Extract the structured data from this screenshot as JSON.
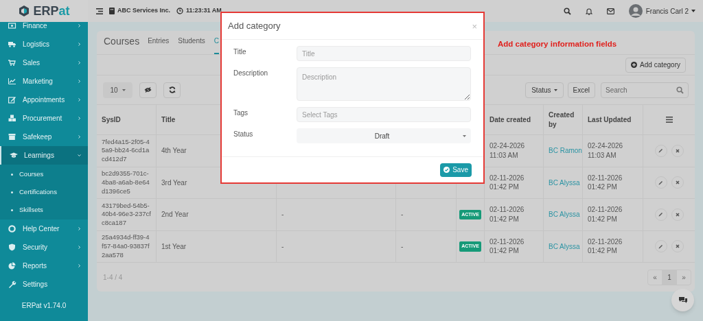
{
  "app": {
    "logo_dark": "ERP",
    "logo_accent": "at",
    "version": "ERPat v1.74.0"
  },
  "header": {
    "company": "ABC Services Inc.",
    "time": "11:23:31 AM",
    "user": "Francis Carl 2"
  },
  "sidebar": {
    "items": [
      {
        "label": "Finance",
        "kind": "menu",
        "expanded": false,
        "selected": false
      },
      {
        "label": "Logistics",
        "kind": "menu",
        "expanded": false,
        "selected": false
      },
      {
        "label": "Sales",
        "kind": "menu",
        "expanded": false,
        "selected": false
      },
      {
        "label": "Marketing",
        "kind": "menu",
        "expanded": false,
        "selected": false
      },
      {
        "label": "Appointments",
        "kind": "menu",
        "expanded": false,
        "selected": false
      },
      {
        "label": "Procurement",
        "kind": "menu",
        "expanded": false,
        "selected": false
      },
      {
        "label": "Safekeep",
        "kind": "menu",
        "expanded": false,
        "selected": false
      },
      {
        "label": "Learnings",
        "kind": "menu",
        "expanded": true,
        "selected": true,
        "children": [
          {
            "label": "Courses"
          },
          {
            "label": "Certifications"
          },
          {
            "label": "Skillsets"
          }
        ]
      },
      {
        "label": "Help Center",
        "kind": "menu",
        "expanded": false,
        "selected": false
      },
      {
        "label": "Security",
        "kind": "menu",
        "expanded": false,
        "selected": false
      },
      {
        "label": "Reports",
        "kind": "menu",
        "expanded": false,
        "selected": false
      },
      {
        "label": "Settings",
        "kind": "link",
        "selected": false
      }
    ]
  },
  "page": {
    "title": "Courses",
    "tabs": [
      {
        "label": "Entries",
        "selected": false
      },
      {
        "label": "Students",
        "selected": false
      },
      {
        "label": "C",
        "selected": true
      }
    ],
    "add_button": "Add category"
  },
  "toolbar": {
    "page_size": "10",
    "status_filter": "Status",
    "export": "Excel",
    "search_placeholder": "Search"
  },
  "table": {
    "columns": {
      "sysid": "SysID",
      "title": "Title",
      "date_created": "Date created",
      "created_by": "Created by",
      "last_updated": "Last Updated"
    },
    "rows": [
      {
        "sysid": "7fed4a15-2f05-45a9-bb24-6cd1acd412d7",
        "title": "4th Year",
        "date_created": "02-24-2026 11:03 AM",
        "created_by": "BC Ramon",
        "last_updated": "02-24-2026 11:03 AM"
      },
      {
        "sysid": "bc2d9355-701c-4ba8-a6ab-8e64d1396ce5",
        "title": "3rd Year",
        "date_created": "02-11-2026 01:42 PM",
        "created_by": "BC Alyssa",
        "last_updated": "02-11-2026 01:42 PM"
      },
      {
        "sysid": "43179bed-54b5-40b4-96e3-237cfc8ca187",
        "title": "2nd Year",
        "column_3": "-",
        "column_4": "-",
        "status": "ACTIVE",
        "date_created": "02-11-2026 01:42 PM",
        "created_by": "BC Alyssa",
        "last_updated": "02-11-2026 01:42 PM"
      },
      {
        "sysid": "25a4934d-ff39-4f57-84a0-93837f2aa578",
        "title": "1st Year",
        "column_3": "-",
        "column_4": "-",
        "status": "ACTIVE",
        "date_created": "02-11-2026 01:42 PM",
        "created_by": "BC Alyssa",
        "last_updated": "02-11-2026 01:42 PM"
      }
    ]
  },
  "pagination": {
    "summary": "1-4 / 4",
    "prev": "«",
    "pages": [
      {
        "label": "1",
        "selected": true
      }
    ],
    "next": "»"
  },
  "modal": {
    "title": "Add category",
    "close": "×",
    "fields": [
      {
        "label": "Title",
        "kind": "text",
        "placeholder": "Title"
      },
      {
        "label": "Description",
        "kind": "textarea",
        "placeholder": "Description"
      },
      {
        "label": "Tags",
        "kind": "text",
        "placeholder": "Select Tags"
      },
      {
        "label": "Status",
        "kind": "select",
        "value": "Draft"
      }
    ],
    "save": "Save"
  },
  "annotation": "Add category information fields"
}
